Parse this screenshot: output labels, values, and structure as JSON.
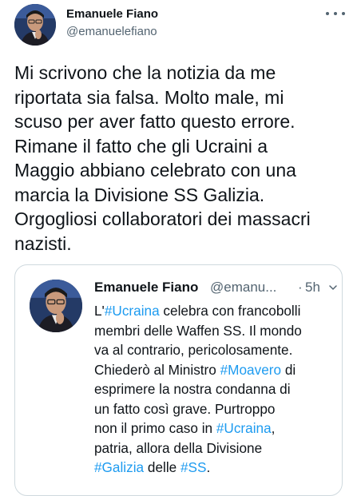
{
  "tweet": {
    "author_name": "Emanuele Fiano",
    "author_handle": "@emanuelefiano",
    "more_icon": "more-horizontal-icon",
    "text_lines": [
      "Mi scrivono che la notizia da me",
      "riportata sia falsa. Molto male, mi",
      "scuso per aver fatto questo errore.",
      "Rimane il fatto che gli Ucraini a",
      "Maggio abbiano celebrato con una",
      "marcia la Divisione SS Galizia.",
      "Orgogliosi collaboratori dei massacri",
      "nazisti."
    ]
  },
  "quote": {
    "author_name": "Emanuele Fiano",
    "author_handle": "@emanu...",
    "separator": "·",
    "time": "5h",
    "chevron_icon": "chevron-down-icon",
    "line1_prefix": "L'",
    "hashtag_ucraina_1": "#Ucraina",
    "line1_suffix": " celebra con francobolli",
    "line2": "membri delle Waffen SS. Il mondo",
    "line3": "va al contrario, pericolosamente.",
    "line4_prefix": "Chiederò al Ministro ",
    "hashtag_moavero": "#Moavero",
    "line4_suffix": " di",
    "line5": "esprimere la nostra condanna di",
    "line6": "un fatto così grave. Purtroppo",
    "line7_prefix": "non il primo caso in ",
    "hashtag_ucraina_2": "#Ucraina",
    "line7_suffix": ",",
    "line8": "patria, allora della Divisione",
    "hashtag_galizia": "#Galizia",
    "line9_middle": " delle ",
    "hashtag_ss": "#SS",
    "line9_suffix": "."
  },
  "colors": {
    "text": "#0f1419",
    "secondary": "#536471",
    "hashtag": "#1d9bf0",
    "border": "#cfd9de"
  }
}
